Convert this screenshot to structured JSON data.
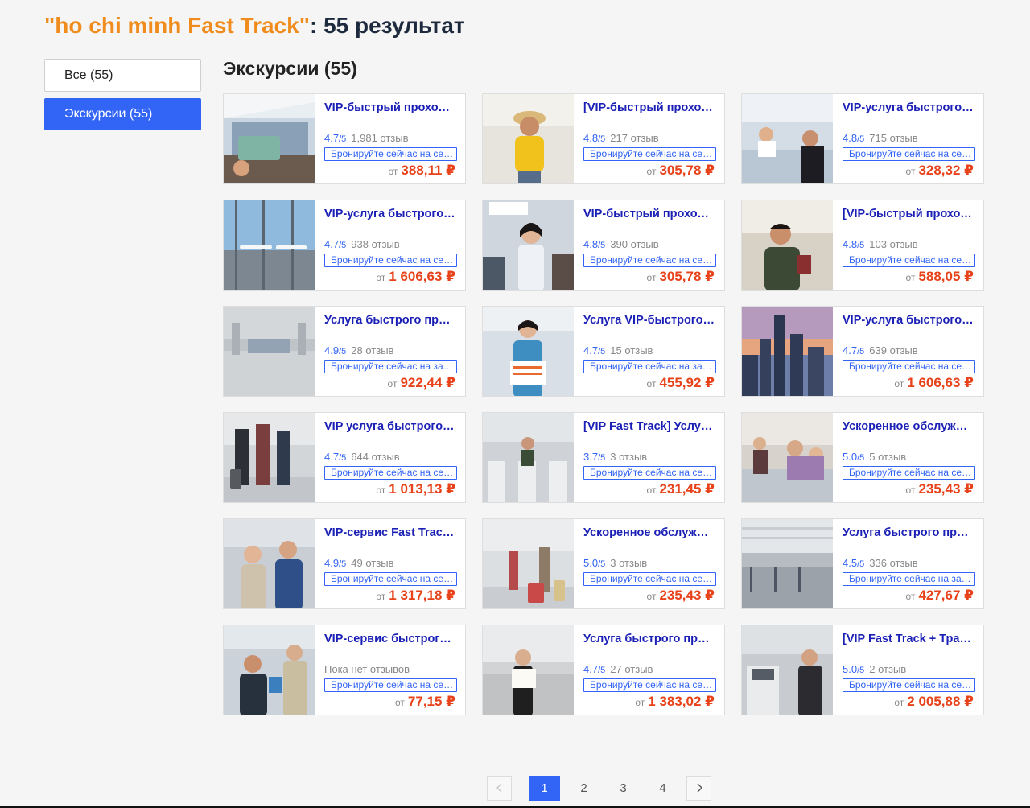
{
  "header": {
    "quote_open": "\"",
    "query": "ho chi minh Fast Track",
    "quote_close": "\"",
    "suffix": ": 55 результат"
  },
  "sidebar": {
    "items": [
      {
        "label": "Все (55)",
        "active": false
      },
      {
        "label": "Экскурсии (55)",
        "active": true
      }
    ]
  },
  "section": {
    "title": "Экскурсии (55)"
  },
  "common": {
    "out_of": "/5",
    "from_label": "от",
    "no_reviews": "Пока нет отзывов"
  },
  "cards": [
    {
      "title": "VIP-быстрый проход в аэропорту Таншоннят",
      "score": "4.7",
      "reviews": "1,981 отзыв",
      "book": "Бронируйте сейчас на сегодня",
      "price": "388,11 ₽",
      "thumb": "airport-hand"
    },
    {
      "title": "[VIP-быстрый проход в аэропорту Хошимина]",
      "score": "4.8",
      "reviews": "217 отзыв",
      "book": "Бронируйте сейчас на сегодня",
      "price": "305,78 ₽",
      "thumb": "yellow-woman"
    },
    {
      "title": "VIP-услуга быстрого прохода в аэропорту",
      "score": "4.8",
      "reviews": "715 отзыв",
      "book": "Бронируйте сейчас на сегодня",
      "price": "328,32 ₽",
      "thumb": "counter"
    },
    {
      "title": "VIP-услуга быстрого прохода Таншоннят",
      "score": "4.7",
      "reviews": "938 отзыв",
      "book": "Бронируйте сейчас на сегодня",
      "price": "1 606,63 ₽",
      "thumb": "planes"
    },
    {
      "title": "VIP-быстрый проход и встреча в аэропорту",
      "score": "4.8",
      "reviews": "390 отзыв",
      "book": "Бронируйте сейчас на сегодня",
      "price": "305,78 ₽",
      "thumb": "welcome"
    },
    {
      "title": "[VIP-быстрый проход в аэропорту Хошимина]",
      "score": "4.8",
      "reviews": "103 отзыв",
      "book": "Бронируйте сейчас на сегодня",
      "price": "588,05 ₽",
      "thumb": "man-passport"
    },
    {
      "title": "Услуга быстрого прохода в аэропорту",
      "score": "4.9",
      "reviews": "28 отзыв",
      "book": "Бронируйте сейчас на завтра",
      "price": "922,44 ₽",
      "thumb": "hall"
    },
    {
      "title": "Услуга VIP-быстрого прохода в аэропорту",
      "score": "4.7",
      "reviews": "15 отзыв",
      "book": "Бронируйте сейчас на завтра",
      "price": "455,92 ₽",
      "thumb": "blue-woman"
    },
    {
      "title": "VIP-услуга быстрого прохода и трансфер",
      "score": "4.7",
      "reviews": "639 отзыв",
      "book": "Бронируйте сейчас на сегодня",
      "price": "1 606,63 ₽",
      "thumb": "city"
    },
    {
      "title": "VIP услуга быстрого прохода в аэропорту",
      "score": "4.7",
      "reviews": "644 отзыв",
      "book": "Бронируйте сейчас на сегодня",
      "price": "1 013,13 ₽",
      "thumb": "queue"
    },
    {
      "title": "[VIP Fast Track] Услуга быстрого прохода",
      "score": "3.7",
      "reviews": "3 отзыв",
      "book": "Бронируйте сейчас на сегодня",
      "price": "231,45 ₽",
      "thumb": "gates"
    },
    {
      "title": "Ускоренное обслуживание в аэропорту",
      "score": "5.0",
      "reviews": "5 отзыв",
      "book": "Бронируйте сейчас на сегодня",
      "price": "235,43 ₽",
      "thumb": "family"
    },
    {
      "title": "VIP-сервис Fast Track в аэропорту Таншоннят",
      "score": "4.9",
      "reviews": "49 отзыв",
      "book": "Бронируйте сейчас на сегодня",
      "price": "1 317,18 ₽",
      "thumb": "couple"
    },
    {
      "title": "Ускоренное обслуживание в аэропорту",
      "score": "5.0",
      "reviews": "3 отзыв",
      "book": "Бронируйте сейчас на сегодня",
      "price": "235,43 ₽",
      "thumb": "luggage"
    },
    {
      "title": "Услуга быстрого прохода в аэропорту",
      "score": "4.5",
      "reviews": "336 отзыв",
      "book": "Бронируйте сейчас на завтра",
      "price": "427,67 ₽",
      "thumb": "terminal"
    },
    {
      "title": "VIP-сервис быстрого прохода в аэропорту",
      "score": "",
      "reviews": "",
      "book": "Бронируйте сейчас на сегодня",
      "price": "77,15 ₽",
      "thumb": "officer"
    },
    {
      "title": "Услуга быстрого прохода в аэропорту",
      "score": "4.7",
      "reviews": "27 отзыв",
      "book": "Бронируйте сейчас на сегодня",
      "price": "1 383,02 ₽",
      "thumb": "sign-woman"
    },
    {
      "title": "[VIP Fast Track + Трансфер в аэропорту]",
      "score": "5.0",
      "reviews": "2 отзыв",
      "book": "Бронируйте сейчас на сегодня",
      "price": "2 005,88 ₽",
      "thumb": "checkin"
    }
  ],
  "pagination": {
    "pages": [
      "1",
      "2",
      "3",
      "4"
    ],
    "current": "1"
  },
  "colors": {
    "accent": "#3264f6",
    "query": "#f08c1d",
    "price": "#e8421a",
    "title_link": "#1a1fb5"
  }
}
